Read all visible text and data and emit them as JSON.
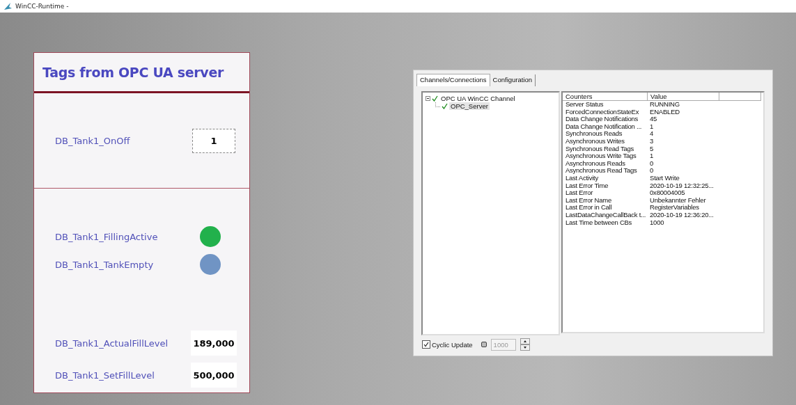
{
  "window": {
    "title": "WinCC-Runtime -"
  },
  "hmi_panel": {
    "title": "Tags from OPC UA server",
    "sections": [
      {
        "rows": [
          {
            "kind": "field",
            "label": "DB_Tank1_OnOff",
            "value": "1"
          }
        ]
      },
      {
        "rows": [
          {
            "kind": "lamp",
            "label": "DB_Tank1_FillingActive",
            "color": "#22b14c"
          },
          {
            "kind": "lamp",
            "label": "DB_Tank1_TankEmpty",
            "color": "#7094c4"
          },
          {
            "kind": "gap"
          },
          {
            "kind": "value",
            "label": "DB_Tank1_ActualFillLevel",
            "value": "189,000"
          },
          {
            "kind": "value",
            "label": "DB_Tank1_SetFillLevel",
            "value": "500,000"
          }
        ]
      }
    ]
  },
  "diagnostics": {
    "tabs": [
      {
        "label": "Channels/Connections",
        "selected": true
      },
      {
        "label": "Configuration",
        "selected": false
      }
    ],
    "tree": [
      {
        "label": "OPC UA WinCC Channel",
        "expanded": true,
        "selected": false,
        "children": [
          {
            "label": "OPC_Server",
            "selected": true
          }
        ]
      }
    ],
    "columns": [
      "Counters",
      "Value"
    ],
    "rows": [
      [
        "Server Status",
        "RUNNING"
      ],
      [
        "ForcedConnectionStateEx",
        "ENABLED"
      ],
      [
        "Data Change Notifications",
        "45"
      ],
      [
        "Data Change Notification ...",
        "1"
      ],
      [
        "Synchronous Reads",
        "4"
      ],
      [
        "Asynchronous Writes",
        "3"
      ],
      [
        "Synchronous Read Tags",
        "5"
      ],
      [
        "Asynchronous Write Tags",
        "1"
      ],
      [
        "Asynchronous Reads",
        "0"
      ],
      [
        "Asynchronous Read Tags",
        "0"
      ],
      [
        "Last Activity",
        "Start Write"
      ],
      [
        "Last Error Time",
        "2020-10-19 12:32:25..."
      ],
      [
        "Last Error",
        "0x80004005"
      ],
      [
        "Last Error Name",
        "Unbekannter Fehler"
      ],
      [
        "Last Error in Call",
        "RegisterVariables"
      ],
      [
        "LastDataChangeCallBack t...",
        "2020-10-19 12:36:20..."
      ],
      [
        "Last Time between CBs",
        "1000"
      ]
    ],
    "cyclic_update": {
      "label": "Cyclic Update",
      "checked": true
    },
    "interval": {
      "value": "1000",
      "disabled": true
    }
  }
}
